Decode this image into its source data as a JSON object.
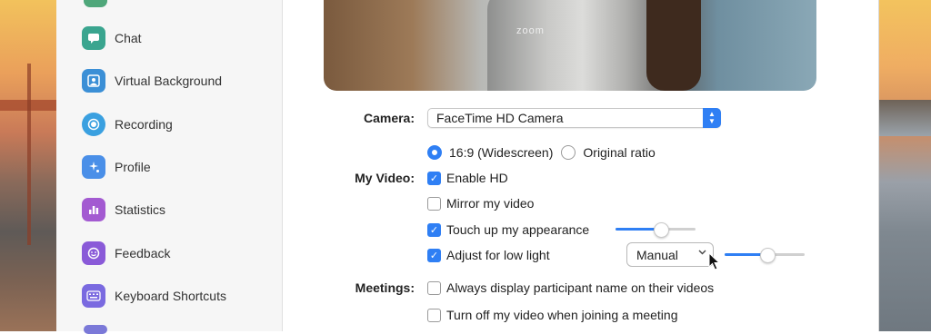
{
  "sidebar": {
    "items": [
      {
        "label": "Chat",
        "icon": "chat-icon",
        "color": "#3aa58f"
      },
      {
        "label": "Virtual Background",
        "icon": "virtual-background-icon",
        "color": "#3b8fd6"
      },
      {
        "label": "Recording",
        "icon": "recording-icon",
        "color": "#3aa0e0"
      },
      {
        "label": "Profile",
        "icon": "profile-icon",
        "color": "#4a8fe8"
      },
      {
        "label": "Statistics",
        "icon": "statistics-icon",
        "color": "#a35ad1"
      },
      {
        "label": "Feedback",
        "icon": "feedback-icon",
        "color": "#8a5ad8"
      },
      {
        "label": "Keyboard Shortcuts",
        "icon": "keyboard-icon",
        "color": "#7a6ae0"
      }
    ]
  },
  "video": {
    "logo_text": "zoom"
  },
  "camera": {
    "label": "Camera:",
    "selected": "FaceTime HD Camera"
  },
  "my_video": {
    "label": "My Video:",
    "ratio_widescreen": "16:9 (Widescreen)",
    "ratio_original": "Original ratio",
    "enable_hd": "Enable HD",
    "mirror": "Mirror my video",
    "touch_up": "Touch up my appearance",
    "low_light": "Adjust for low light",
    "low_light_mode": "Manual",
    "touch_up_level": 0.56,
    "low_light_level": 0.52
  },
  "meetings": {
    "label": "Meetings:",
    "display_names": "Always display participant name on their videos",
    "turn_off_video": "Turn off my video when joining a meeting"
  },
  "colors": {
    "accent": "#2f7ff4"
  }
}
